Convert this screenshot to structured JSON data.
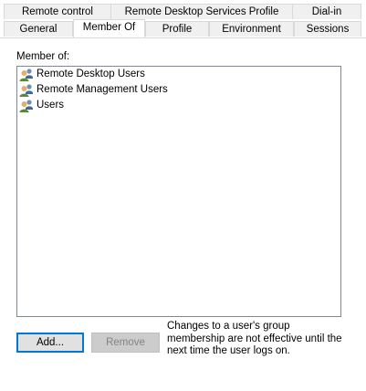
{
  "tabs_row1": [
    {
      "label": "Remote control"
    },
    {
      "label": "Remote Desktop Services Profile"
    },
    {
      "label": "Dial-in"
    }
  ],
  "tabs_row2": [
    {
      "label": "General"
    },
    {
      "label": "Member Of",
      "selected": true
    },
    {
      "label": "Profile"
    },
    {
      "label": "Environment"
    },
    {
      "label": "Sessions"
    }
  ],
  "member_of": {
    "label": "Member of:",
    "items": [
      {
        "name": "Remote Desktop Users",
        "icon": "group-icon"
      },
      {
        "name": "Remote Management Users",
        "icon": "group-icon"
      },
      {
        "name": "Users",
        "icon": "group-icon"
      }
    ]
  },
  "buttons": {
    "add_label": "Add...",
    "remove_label": "Remove"
  },
  "note": "Changes to a user's group membership are not effective until the next time the user logs on.",
  "colors": {
    "focus_border": "#0078d7",
    "disabled_text": "#838383"
  }
}
